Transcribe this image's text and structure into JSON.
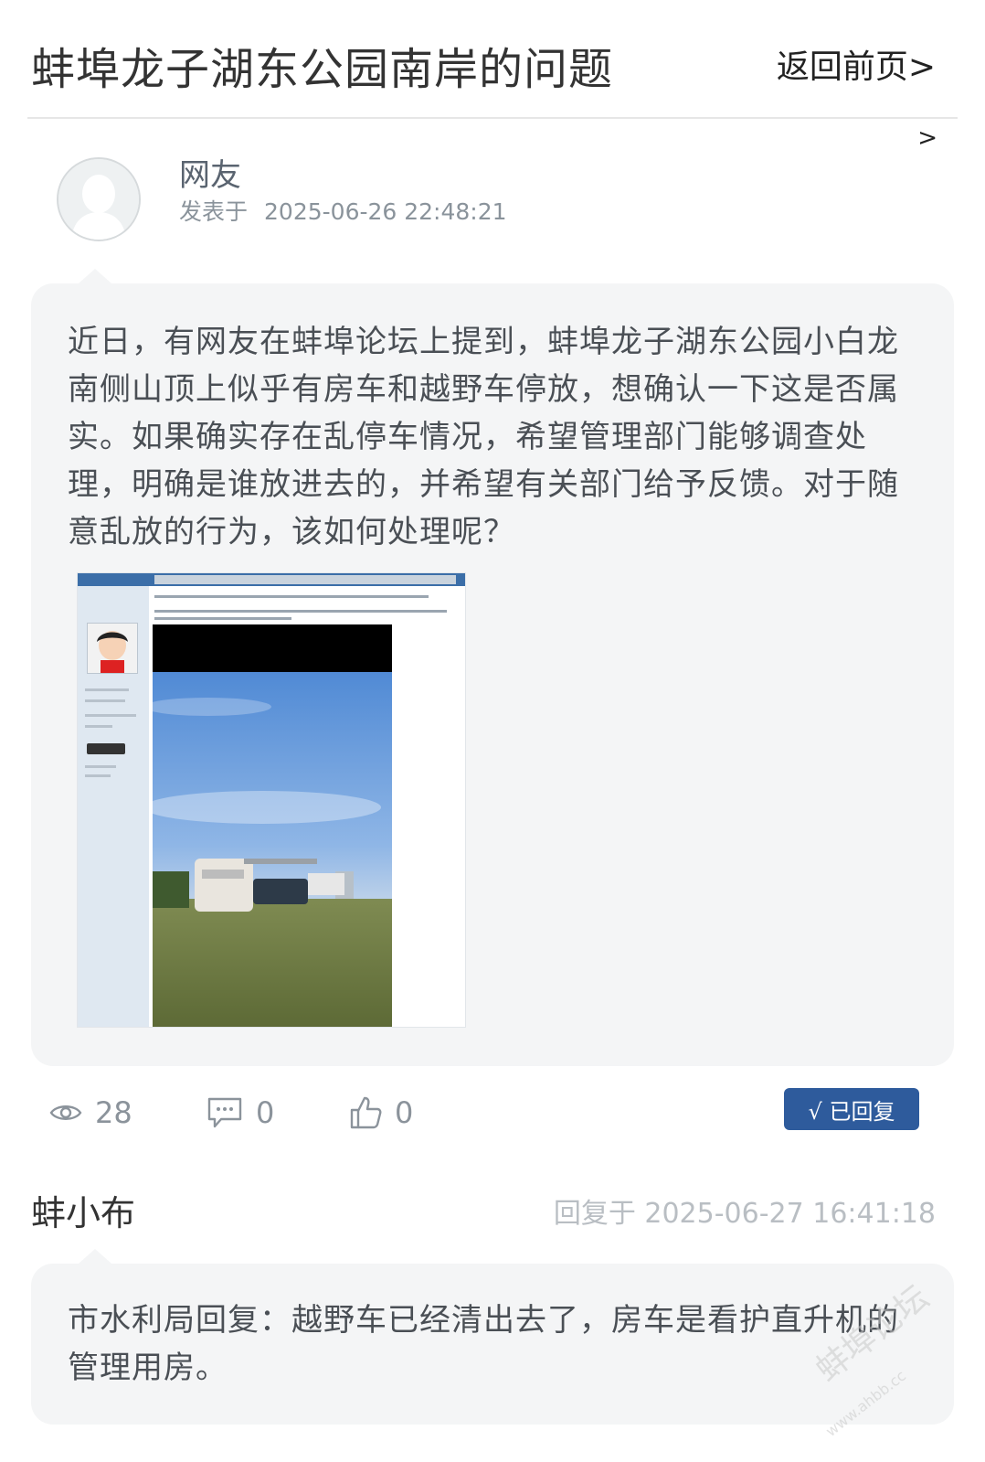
{
  "header": {
    "title": "蚌埠龙子湖东公园南岸的问题",
    "back_label": "返回前页>",
    "more_glyph": ">"
  },
  "post": {
    "author": "网友",
    "posted_label": "发表于",
    "posted_time": "2025-06-26 22:48:21",
    "content": "近日，有网友在蚌埠论坛上提到，蚌埠龙子湖东公园小白龙南侧山顶上似乎有房车和越野车停放，想确认一下这是否属实。如果确实存在乱停车情况，希望管理部门能够调查处理，明确是谁放进去的，并希望有关部门给予反馈。对于随意乱放的行为，该如何处理呢？"
  },
  "stats": {
    "views": "28",
    "comments": "0",
    "likes": "0",
    "status_badge": "√ 已回复"
  },
  "reply": {
    "author": "蚌小布",
    "time_label": "回复于 2025-06-27 16:41:18",
    "content": "市水利局回复：越野车已经清出去了，房车是看护直升机的管理用房。"
  },
  "watermark": {
    "brand": "蚌埠论坛",
    "url": "www.ahbb.cc"
  },
  "colors": {
    "badge": "#2e5b9c",
    "bubble": "#f4f5f6"
  }
}
